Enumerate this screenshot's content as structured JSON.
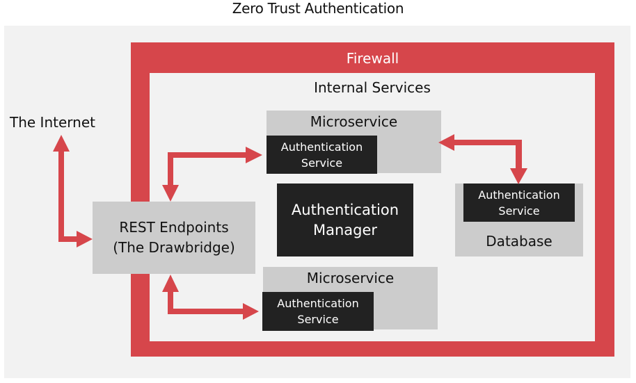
{
  "title": "Zero Trust Authentication",
  "colors": {
    "firewall": "#d6464b",
    "background": "#f2f2f2",
    "box_gray": "#cccccc",
    "box_dark": "#222222",
    "arrow": "#d6464b"
  },
  "firewall": {
    "label": "Firewall"
  },
  "internal_services": {
    "label": "Internal Services"
  },
  "internet": {
    "label": "The Internet"
  },
  "rest_endpoints": {
    "line1": "REST Endpoints",
    "line2": "(The Drawbridge)"
  },
  "microservice_top": {
    "label": "Microservice",
    "auth_service": {
      "line1": "Authentication",
      "line2": "Service"
    }
  },
  "microservice_bottom": {
    "label": "Microservice",
    "auth_service": {
      "line1": "Authentication",
      "line2": "Service"
    }
  },
  "auth_manager": {
    "line1": "Authentication",
    "line2": "Manager"
  },
  "database": {
    "label": "Database",
    "auth_service": {
      "line1": "Authentication",
      "line2": "Service"
    }
  },
  "connections": [
    {
      "from": "The Internet",
      "to": "REST Endpoints",
      "bidirectional": true
    },
    {
      "from": "REST Endpoints",
      "to": "Microservice (top)",
      "bidirectional": true
    },
    {
      "from": "REST Endpoints",
      "to": "Microservice (bottom)",
      "bidirectional": true
    },
    {
      "from": "Microservice (top)",
      "to": "Database",
      "bidirectional": true
    }
  ]
}
